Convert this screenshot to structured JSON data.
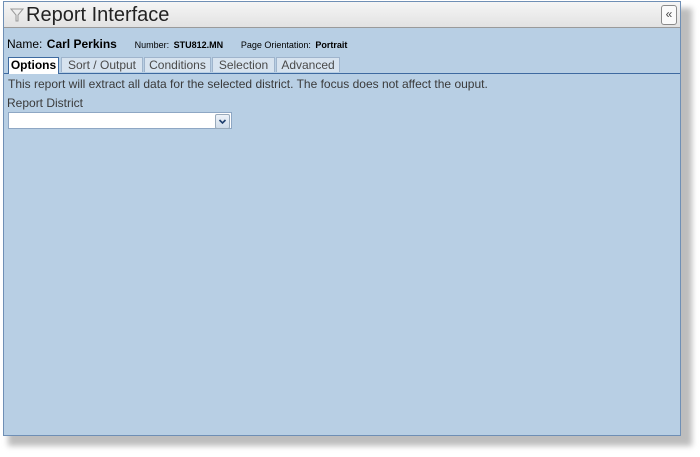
{
  "window": {
    "title": "Report Interface",
    "collapse_glyph": "«"
  },
  "report": {
    "name_label": "Name:",
    "name": "Carl Perkins",
    "number_label": "Number:",
    "number": "STU812.MN",
    "orientation_label": "Page Orientation:",
    "orientation": "Portrait"
  },
  "tabs": [
    {
      "label": "Options",
      "active": true
    },
    {
      "label": "Sort / Output",
      "active": false
    },
    {
      "label": "Conditions",
      "active": false
    },
    {
      "label": "Selection",
      "active": false
    },
    {
      "label": "Advanced",
      "active": false
    }
  ],
  "options": {
    "description": "This report will extract all data for the selected district. The focus does not affect the ouput.",
    "district_label": "Report District",
    "district_value": ""
  },
  "icons": {
    "title": "filter-icon",
    "collapse": "double-chevron-left-icon",
    "dropdown": "chevron-down-icon"
  },
  "colors": {
    "panel": "#b8cfe4",
    "border": "#3e6aa0"
  }
}
